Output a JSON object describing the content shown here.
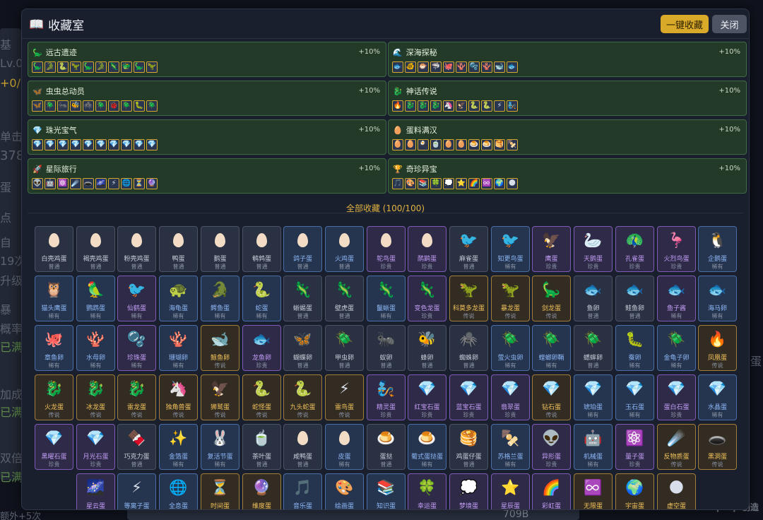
{
  "background": {
    "left_fragments": [
      "基",
      "Lv.0",
      "+0/3",
      "单击",
      "378",
      "蛋",
      "点",
      "自",
      "19次",
      "升级",
      "暴",
      "概率",
      "已满",
      "加成",
      "已满",
      "双倍",
      "已满",
      "额外+5次"
    ],
    "right_fragments": [
      "蛋"
    ],
    "bottom_value": "709B",
    "watermark": "TapTap 创造"
  },
  "modal": {
    "title_icon": "📖",
    "title": "收藏室",
    "collect_all_label": "一键收藏",
    "close_label": "关闭"
  },
  "series": [
    {
      "icon": "🦕",
      "name": "远古遗迹",
      "bonus": "+10%",
      "icons": [
        "🦕",
        "🐊",
        "🐍",
        "🦖",
        "🦕",
        "🐊",
        "🦎",
        "🐲",
        "🦕",
        "🦖"
      ]
    },
    {
      "icon": "🌊",
      "name": "深海探秘",
      "bonus": "+10%",
      "icons": [
        "🐟",
        "🐠",
        "🐡",
        "🦈",
        "🐙",
        "🪸",
        "🫧",
        "🪸",
        "🐋",
        "🐟"
      ]
    },
    {
      "icon": "🦋",
      "name": "虫虫总动员",
      "bonus": "+10%",
      "icons": [
        "🦋",
        "🪲",
        "🐜",
        "🐝",
        "🕷️",
        "🪲",
        "🐞",
        "🪲",
        "🐛",
        "🪲"
      ]
    },
    {
      "icon": "🐉",
      "name": "神话传说",
      "bonus": "+10%",
      "icons": [
        "🔥",
        "🐉",
        "🐉",
        "🐉",
        "🦄",
        "🦅",
        "🐍",
        "🐍",
        "⚡",
        "🧞"
      ]
    },
    {
      "icon": "💎",
      "name": "珠光宝气",
      "bonus": "+10%",
      "icons": [
        "💎",
        "💎",
        "💎",
        "💎",
        "💎",
        "💎",
        "💎",
        "💎",
        "💎",
        "💎"
      ]
    },
    {
      "icon": "🥚",
      "name": "蛋料满汉",
      "bonus": "+10%",
      "icons": [
        "🥚",
        "🥚",
        "🍳",
        "🍵",
        "🥚",
        "🥚",
        "🍮",
        "🍮",
        "🥞",
        "🍢"
      ]
    },
    {
      "icon": "🚀",
      "name": "星际旅行",
      "bonus": "+10%",
      "icons": [
        "👽",
        "🤖",
        "⚛️",
        "☄️",
        "🕳️",
        "🌌",
        "⚡",
        "🌐",
        "⏳",
        "🔮"
      ]
    },
    {
      "icon": "🏆",
      "name": "奇珍异宝",
      "bonus": "+10%",
      "icons": [
        "🎵",
        "🎨",
        "📚",
        "🍀",
        "💭",
        "⭐",
        "🌈",
        "♾️",
        "🌍",
        "🌑"
      ]
    }
  ],
  "collection_title": "全部收藏 (100/100)",
  "collection": [
    {
      "icon": "egg",
      "name": "白壳鸡蛋",
      "rarity": "普通",
      "tier": 0
    },
    {
      "icon": "egg",
      "name": "褐壳鸡蛋",
      "rarity": "普通",
      "tier": 0
    },
    {
      "icon": "egg",
      "name": "粉壳鸡蛋",
      "rarity": "普通",
      "tier": 0
    },
    {
      "icon": "egg",
      "name": "鸭蛋",
      "rarity": "普通",
      "tier": 0
    },
    {
      "icon": "egg",
      "name": "鹅蛋",
      "rarity": "普通",
      "tier": 0
    },
    {
      "icon": "egg",
      "name": "鹌鹑蛋",
      "rarity": "普通",
      "tier": 0
    },
    {
      "icon": "egg",
      "name": "鸽子蛋",
      "rarity": "普通",
      "tier": 1
    },
    {
      "icon": "egg",
      "name": "火鸡蛋",
      "rarity": "普通",
      "tier": 1
    },
    {
      "icon": "egg",
      "name": "鸵鸟蛋",
      "rarity": "珍贵",
      "tier": 2
    },
    {
      "icon": "egg",
      "name": "鸸鹋蛋",
      "rarity": "珍贵",
      "tier": 2
    },
    {
      "icon": "🐦",
      "name": "麻雀蛋",
      "rarity": "普通",
      "tier": 0
    },
    {
      "icon": "🐦",
      "name": "知更鸟蛋",
      "rarity": "稀有",
      "tier": 1
    },
    {
      "icon": "🦅",
      "name": "鹰蛋",
      "rarity": "珍贵",
      "tier": 2
    },
    {
      "icon": "🦢",
      "name": "天鹅蛋",
      "rarity": "珍贵",
      "tier": 2
    },
    {
      "icon": "🦚",
      "name": "孔雀蛋",
      "rarity": "珍贵",
      "tier": 2
    },
    {
      "icon": "🦩",
      "name": "火烈鸟蛋",
      "rarity": "珍贵",
      "tier": 2
    },
    {
      "icon": "🐧",
      "name": "企鹅蛋",
      "rarity": "稀有",
      "tier": 1
    },
    {
      "icon": "🦉",
      "name": "猫头鹰蛋",
      "rarity": "稀有",
      "tier": 1
    },
    {
      "icon": "🦜",
      "name": "鹦鹉蛋",
      "rarity": "稀有",
      "tier": 1
    },
    {
      "icon": "🐦",
      "name": "仙鹤蛋",
      "rarity": "稀有",
      "tier": 2
    },
    {
      "icon": "🐢",
      "name": "海龟蛋",
      "rarity": "稀有",
      "tier": 1
    },
    {
      "icon": "🐊",
      "name": "鳄鱼蛋",
      "rarity": "稀有",
      "tier": 1
    },
    {
      "icon": "🐍",
      "name": "蛇蛋",
      "rarity": "稀有",
      "tier": 1
    },
    {
      "icon": "🦎",
      "name": "蜥蜴蛋",
      "rarity": "普通",
      "tier": 0
    },
    {
      "icon": "🦎",
      "name": "壁虎蛋",
      "rarity": "普通",
      "tier": 0
    },
    {
      "icon": "🦎",
      "name": "鬣蜥蛋",
      "rarity": "稀有",
      "tier": 1
    },
    {
      "icon": "🦎",
      "name": "变色龙蛋",
      "rarity": "珍贵",
      "tier": 2
    },
    {
      "icon": "🦖",
      "name": "科莫多龙蛋",
      "rarity": "传说",
      "tier": 3
    },
    {
      "icon": "🦖",
      "name": "暴龙蛋",
      "rarity": "传说",
      "tier": 3
    },
    {
      "icon": "🦕",
      "name": "剑龙蛋",
      "rarity": "传说",
      "tier": 3
    },
    {
      "icon": "🐟",
      "name": "鱼卵",
      "rarity": "普通",
      "tier": 0
    },
    {
      "icon": "🐟",
      "name": "鲑鱼卵",
      "rarity": "普通",
      "tier": 0
    },
    {
      "icon": "🐟",
      "name": "鱼子酱",
      "rarity": "稀有",
      "tier": 2
    },
    {
      "icon": "🐟",
      "name": "海马卵",
      "rarity": "稀有",
      "tier": 1
    },
    {
      "icon": "🐙",
      "name": "章鱼卵",
      "rarity": "稀有",
      "tier": 1
    },
    {
      "icon": "🪸",
      "name": "水母卵",
      "rarity": "稀有",
      "tier": 1
    },
    {
      "icon": "🫧",
      "name": "珍珠蛋",
      "rarity": "稀有",
      "tier": 2
    },
    {
      "icon": "🪸",
      "name": "珊瑚卵",
      "rarity": "稀有",
      "tier": 1
    },
    {
      "icon": "🐋",
      "name": "鲸鱼卵",
      "rarity": "传说",
      "tier": 3
    },
    {
      "icon": "🐟",
      "name": "龙鱼卵",
      "rarity": "珍贵",
      "tier": 2
    },
    {
      "icon": "🦋",
      "name": "蝴蝶卵",
      "rarity": "普通",
      "tier": 0
    },
    {
      "icon": "🪲",
      "name": "甲虫卵",
      "rarity": "普通",
      "tier": 0
    },
    {
      "icon": "🐜",
      "name": "蚁卵",
      "rarity": "普通",
      "tier": 0
    },
    {
      "icon": "🐝",
      "name": "蜂卵",
      "rarity": "普通",
      "tier": 0
    },
    {
      "icon": "🕷️",
      "name": "蜘蛛卵",
      "rarity": "普通",
      "tier": 0
    },
    {
      "icon": "🪲",
      "name": "萤火虫卵",
      "rarity": "稀有",
      "tier": 1
    },
    {
      "icon": "🪲",
      "name": "螳螂卵鞘",
      "rarity": "稀有",
      "tier": 1
    },
    {
      "icon": "🪲",
      "name": "蟋蟀卵",
      "rarity": "普通",
      "tier": 0
    },
    {
      "icon": "🐛",
      "name": "蚕卵",
      "rarity": "稀有",
      "tier": 1
    },
    {
      "icon": "🪲",
      "name": "金龟子卵",
      "rarity": "稀有",
      "tier": 1
    },
    {
      "icon": "🔥",
      "name": "凤凰蛋",
      "rarity": "传说",
      "tier": 3
    },
    {
      "icon": "🐉",
      "name": "火龙蛋",
      "rarity": "传说",
      "tier": 3
    },
    {
      "icon": "🐉",
      "name": "冰龙蛋",
      "rarity": "传说",
      "tier": 3
    },
    {
      "icon": "🐉",
      "name": "雷龙蛋",
      "rarity": "传说",
      "tier": 3
    },
    {
      "icon": "🦄",
      "name": "独角兽蛋",
      "rarity": "传说",
      "tier": 3
    },
    {
      "icon": "🦅",
      "name": "狮鹫蛋",
      "rarity": "传说",
      "tier": 3
    },
    {
      "icon": "🐍",
      "name": "蛇怪蛋",
      "rarity": "传说",
      "tier": 3
    },
    {
      "icon": "🐍",
      "name": "九头蛇蛋",
      "rarity": "传说",
      "tier": 3
    },
    {
      "icon": "⚡",
      "name": "雷鸟蛋",
      "rarity": "传说",
      "tier": 3
    },
    {
      "icon": "🧞",
      "name": "精灵蛋",
      "rarity": "珍贵",
      "tier": 2
    },
    {
      "icon": "💎",
      "name": "红宝石蛋",
      "rarity": "珍贵",
      "tier": 2
    },
    {
      "icon": "💎",
      "name": "蓝宝石蛋",
      "rarity": "珍贵",
      "tier": 2
    },
    {
      "icon": "💎",
      "name": "翡翠蛋",
      "rarity": "珍贵",
      "tier": 2
    },
    {
      "icon": "💎",
      "name": "钻石蛋",
      "rarity": "传说",
      "tier": 3
    },
    {
      "icon": "💎",
      "name": "琥珀蛋",
      "rarity": "稀有",
      "tier": 1
    },
    {
      "icon": "💎",
      "name": "玉石蛋",
      "rarity": "稀有",
      "tier": 1
    },
    {
      "icon": "💎",
      "name": "蛋白石蛋",
      "rarity": "珍贵",
      "tier": 2
    },
    {
      "icon": "💎",
      "name": "水晶蛋",
      "rarity": "稀有",
      "tier": 1
    },
    {
      "icon": "💎",
      "name": "黑曜石蛋",
      "rarity": "珍贵",
      "tier": 2
    },
    {
      "icon": "💎",
      "name": "月光石蛋",
      "rarity": "珍贵",
      "tier": 2
    },
    {
      "icon": "🍫",
      "name": "巧克力蛋",
      "rarity": "普通",
      "tier": 0
    },
    {
      "icon": "✨",
      "name": "金箔蛋",
      "rarity": "稀有",
      "tier": 1
    },
    {
      "icon": "🐰",
      "name": "复活节蛋",
      "rarity": "稀有",
      "tier": 1
    },
    {
      "icon": "🍵",
      "name": "茶叶蛋",
      "rarity": "普通",
      "tier": 0
    },
    {
      "icon": "egg",
      "name": "咸鸭蛋",
      "rarity": "普通",
      "tier": 0
    },
    {
      "icon": "egg",
      "name": "皮蛋",
      "rarity": "稀有",
      "tier": 1
    },
    {
      "icon": "🍮",
      "name": "蛋挞",
      "rarity": "普通",
      "tier": 0
    },
    {
      "icon": "🍮",
      "name": "葡式蛋挞蛋",
      "rarity": "稀有",
      "tier": 1
    },
    {
      "icon": "🥞",
      "name": "鸡蛋仔蛋",
      "rarity": "普通",
      "tier": 0
    },
    {
      "icon": "🍢",
      "name": "苏格兰蛋",
      "rarity": "稀有",
      "tier": 1
    },
    {
      "icon": "👽",
      "name": "异形蛋",
      "rarity": "珍贵",
      "tier": 2
    },
    {
      "icon": "🤖",
      "name": "机械蛋",
      "rarity": "稀有",
      "tier": 1
    },
    {
      "icon": "⚛️",
      "name": "量子蛋",
      "rarity": "珍贵",
      "tier": 2
    },
    {
      "icon": "☄️",
      "name": "反物质蛋",
      "rarity": "传说",
      "tier": 3
    },
    {
      "icon": "🕳️",
      "name": "黑洞蛋",
      "rarity": "传说",
      "tier": 3
    },
    {
      "icon": "🌌",
      "name": "星云蛋",
      "rarity": "珍贵",
      "tier": 2
    },
    {
      "icon": "⚡",
      "name": "等离子蛋",
      "rarity": "稀有",
      "tier": 1
    },
    {
      "icon": "🌐",
      "name": "全息蛋",
      "rarity": "稀有",
      "tier": 1
    },
    {
      "icon": "⏳",
      "name": "时间蛋",
      "rarity": "传说",
      "tier": 3
    },
    {
      "icon": "🔮",
      "name": "维度蛋",
      "rarity": "传说",
      "tier": 3
    },
    {
      "icon": "🎵",
      "name": "音乐蛋",
      "rarity": "稀有",
      "tier": 1
    },
    {
      "icon": "🎨",
      "name": "绘画蛋",
      "rarity": "稀有",
      "tier": 1
    },
    {
      "icon": "📚",
      "name": "知识蛋",
      "rarity": "稀有",
      "tier": 1
    },
    {
      "icon": "🍀",
      "name": "幸运蛋",
      "rarity": "珍贵",
      "tier": 2
    },
    {
      "icon": "💭",
      "name": "梦境蛋",
      "rarity": "珍贵",
      "tier": 2
    },
    {
      "icon": "⭐",
      "name": "星辰蛋",
      "rarity": "珍贵",
      "tier": 2
    },
    {
      "icon": "🌈",
      "name": "彩虹蛋",
      "rarity": "珍贵",
      "tier": 2
    },
    {
      "icon": "♾️",
      "name": "无限蛋",
      "rarity": "传说",
      "tier": 3
    },
    {
      "icon": "🌍",
      "name": "宇宙蛋",
      "rarity": "传说",
      "tier": 3
    },
    {
      "icon": "🌑",
      "name": "虚空蛋",
      "rarity": "传说",
      "tier": 3
    }
  ]
}
